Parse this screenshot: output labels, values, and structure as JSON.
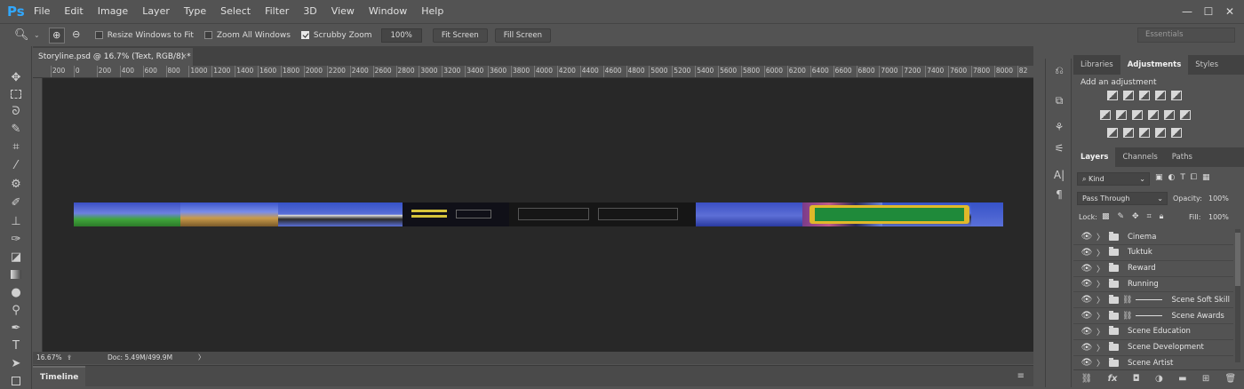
{
  "menubar": {
    "logo": "Ps",
    "items": [
      "File",
      "Edit",
      "Image",
      "Layer",
      "Type",
      "Select",
      "Filter",
      "3D",
      "View",
      "Window",
      "Help"
    ],
    "win_controls": [
      "—",
      "☐",
      "✕"
    ]
  },
  "options": {
    "resize_windows": "Resize Windows to Fit",
    "zoom_all": "Zoom All Windows",
    "scrubby": "Scrubby Zoom",
    "zoom_field": "100%",
    "fit_screen": "Fit Screen",
    "fill_screen": "Fill Screen",
    "workspace": "Essentials"
  },
  "document": {
    "tab_title": "Storyline.psd @ 16.7% (Text, RGB/8) *",
    "tab_close": "×",
    "ruler_labels": [
      "200",
      "0",
      "200",
      "400",
      "600",
      "800",
      "1000",
      "1200",
      "1400",
      "1600",
      "1800",
      "2000",
      "2200",
      "2400",
      "2600",
      "2800",
      "3000",
      "3200",
      "3400",
      "3600",
      "3800",
      "4000",
      "4200",
      "4400",
      "4600",
      "4800",
      "5000",
      "5200",
      "5400",
      "5600",
      "5800",
      "6000",
      "6200",
      "6400",
      "6600",
      "6800",
      "7000",
      "7200",
      "7400",
      "7600",
      "7800",
      "8000",
      "82"
    ]
  },
  "status": {
    "zoom": "16.67%",
    "doc": "Doc: 5.49M/499.9M",
    "arrow": "〉"
  },
  "timeline": {
    "label": "Timeline"
  },
  "panels": {
    "top_tabs": [
      "Libraries",
      "Adjustments",
      "Styles"
    ],
    "adj_title": "Add an adjustment",
    "layer_tabs": [
      "Layers",
      "Channels",
      "Paths"
    ],
    "kind": "Kind",
    "blend_mode": "Pass Through",
    "opacity_label": "Opacity:",
    "opacity_value": "100%",
    "lock_label": "Lock:",
    "fill_label": "Fill:",
    "fill_value": "100%",
    "layers": [
      {
        "name": "Cinema",
        "linked": false
      },
      {
        "name": "Tuktuk",
        "linked": false
      },
      {
        "name": "Reward",
        "linked": false
      },
      {
        "name": "Running",
        "linked": false
      },
      {
        "name": "Scene Soft Skill",
        "linked": true
      },
      {
        "name": "Scene Awards",
        "linked": true
      },
      {
        "name": "Scene Education",
        "linked": false
      },
      {
        "name": "Scene Development",
        "linked": false
      },
      {
        "name": "Scene Artist",
        "linked": false
      }
    ],
    "footer_icons": [
      "link-icon",
      "fx-icon",
      "mask-icon",
      "adjustment-icon",
      "group-icon",
      "new-layer-icon",
      "trash-icon"
    ],
    "footer_fx": "fx"
  }
}
